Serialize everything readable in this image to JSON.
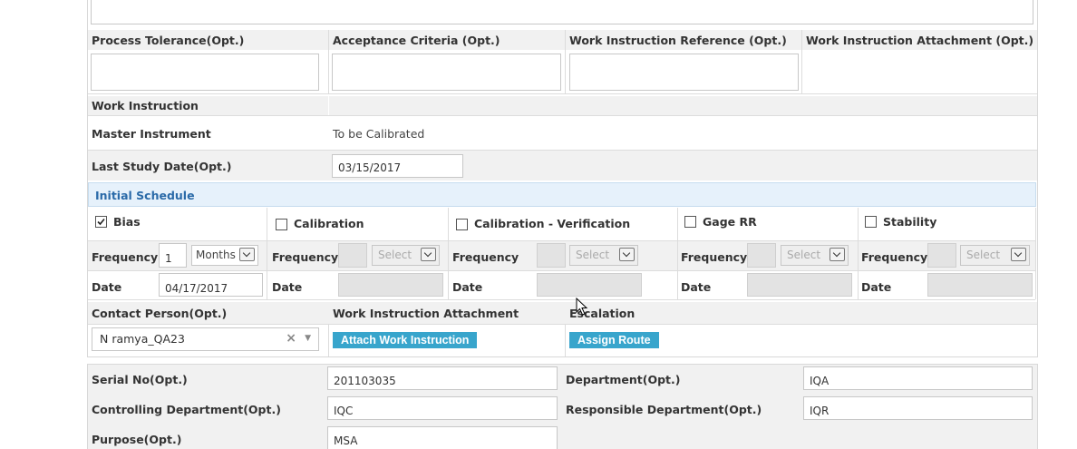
{
  "tolerance_row": {
    "process_tolerance_label": "Process Tolerance(Opt.)",
    "acceptance_criteria_label": "Acceptance Criteria (Opt.)",
    "wi_reference_label": "Work Instruction Reference (Opt.)",
    "wi_attachment_label": "Work Instruction Attachment (Opt.)",
    "process_tolerance_value": "",
    "acceptance_criteria_value": "",
    "wi_reference_value": ""
  },
  "work_instruction_label": "Work Instruction",
  "master_instrument": {
    "label": "Master Instrument",
    "value": "To be Calibrated"
  },
  "last_study_date": {
    "label": "Last Study Date(Opt.)",
    "value": "03/15/2017"
  },
  "initial_schedule": {
    "title": "Initial Schedule",
    "frequency_label": "Frequency",
    "date_label": "Date",
    "select_placeholder": "Select",
    "columns": [
      {
        "name": "Bias",
        "checked": true,
        "frequency": "1",
        "unit": "Months",
        "date": "04/17/2017"
      },
      {
        "name": "Calibration",
        "checked": false
      },
      {
        "name": "Calibration - Verification",
        "checked": false
      },
      {
        "name": "Gage RR",
        "checked": false
      },
      {
        "name": "Stability",
        "checked": false
      }
    ]
  },
  "contact": {
    "label": "Contact Person(Opt.)",
    "value": "N ramya_QA23",
    "wi_attachment_label": "Work Instruction Attachment",
    "attach_button": "Attach Work Instruction",
    "escalation_label": "Escalation",
    "assign_button": "Assign Route"
  },
  "details": {
    "serial_label": "Serial No(Opt.)",
    "serial_value": "201103035",
    "department_label": "Department(Opt.)",
    "department_value": "IQA",
    "controlling_label": "Controlling Department(Opt.)",
    "controlling_value": "IQC",
    "responsible_label": "Responsible Department(Opt.)",
    "responsible_value": "IQR",
    "purpose_label": "Purpose(Opt.)",
    "purpose_value": "MSA"
  },
  "colors": {
    "accent": "#38a5cc",
    "schedule_header_bg": "#e6f1fb",
    "schedule_header_text": "#2a6aa8",
    "row_gray": "#f1f1f1"
  }
}
